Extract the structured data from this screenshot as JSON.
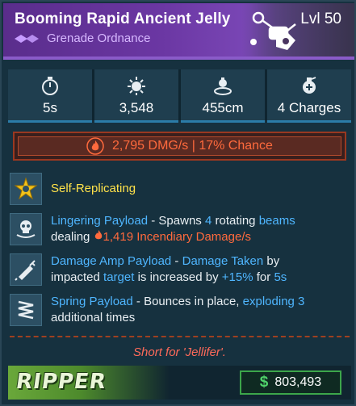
{
  "item": {
    "title": "Booming Rapid Ancient Jelly",
    "level": "Lvl 50",
    "subtitle": "Grenade Ordnance"
  },
  "stats": [
    {
      "icon": "stopwatch-icon",
      "value": "5s"
    },
    {
      "icon": "blast-icon",
      "value": "3,548"
    },
    {
      "icon": "radius-icon",
      "value": "455cm"
    },
    {
      "icon": "grenade-charges-icon",
      "value": "4 Charges"
    }
  ],
  "damage": {
    "icon": "fire-icon",
    "text": "2,795 DMG/s | 17% Chance"
  },
  "perks": [
    {
      "icon": "star-badge-icon",
      "title": "Self-Replicating"
    },
    {
      "icon": "skull-icon",
      "name": "Lingering Payload",
      "sep": " - Spawns ",
      "count": "4",
      "rotating": " rotating ",
      "beams": "beams",
      "line2_a": "dealing ",
      "dmg": "1,419 Incendiary Damage/s"
    },
    {
      "icon": "syringe-icon",
      "name": "Damage Amp Payload",
      "dash": " - ",
      "effect": "Damage Taken",
      "by": " by",
      "line2_a": "impacted ",
      "target": "target",
      "line2_b": " is increased by ",
      "pct": "+15%",
      "line2_c": " for ",
      "dur": "5s"
    },
    {
      "icon": "spring-icon",
      "name": "Spring Payload",
      "desc": " - Bounces in place, ",
      "exploding": "exploding 3",
      "line2": "additional times"
    }
  ],
  "flavor_text": "Short for 'Jellifer'.",
  "footer": {
    "brand": "RIPPER",
    "currency_symbol": "$",
    "price": "803,493"
  },
  "colors": {
    "rarity_purple": "#6b37a3",
    "accent_blue": "#4fb6ff",
    "fire_orange": "#ff6a3d",
    "highlight_yellow": "#ffe24a",
    "money_green": "#4fd16a"
  }
}
